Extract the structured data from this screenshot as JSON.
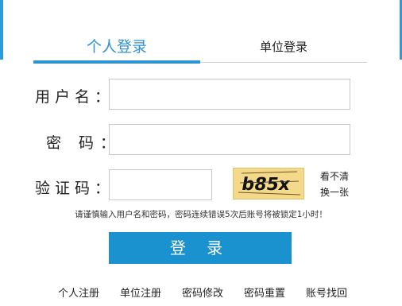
{
  "tabs": {
    "personal_login": "个人登录",
    "unit_login": "单位登录"
  },
  "form": {
    "username_label": "用户名：",
    "password_label": "密 码：",
    "captcha_label": "验证码：",
    "captcha_text": "b85x",
    "captcha_refresh_line1": "看不清",
    "captcha_refresh_line2": "换一张"
  },
  "warning_text": "请谨慎输入用户名和密码，密码连续错误5次后账号将被锁定1小时！",
  "login_button": "登 录",
  "links": {
    "personal_register": "个人注册",
    "unit_register": "单位注册",
    "password_change": "密码修改",
    "password_reset": "密码重置",
    "account_recover": "账号找回"
  },
  "colors": {
    "accent": "#2f93d1",
    "button": "#1a92cf",
    "captcha_bg": "#f5d98a"
  }
}
